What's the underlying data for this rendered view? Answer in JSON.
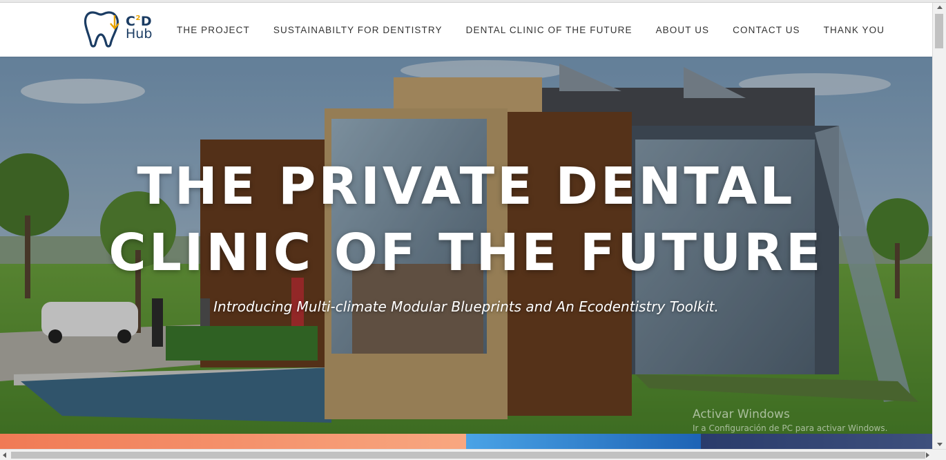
{
  "brand": {
    "logo_line1": "C",
    "logo_sup": "2",
    "logo_line1_end": "D",
    "logo_line2": "Hub",
    "colors": {
      "navy": "#1b3c63",
      "accent": "#e8a300"
    }
  },
  "nav": {
    "items": [
      {
        "label": "THE PROJECT"
      },
      {
        "label": "SUSTAINABILTY FOR DENTISTRY"
      },
      {
        "label": "DENTAL CLINIC OF THE FUTURE"
      },
      {
        "label": "ABOUT US"
      },
      {
        "label": "CONTACT US"
      },
      {
        "label": "THANK YOU"
      }
    ]
  },
  "hero": {
    "title_line1": "THE PRIVATE DENTAL",
    "title_line2": "CLINIC OF THE FUTURE",
    "subtitle": "Introducing Multi-climate Modular Blueprints and An Ecodentistry Toolkit."
  },
  "watermark": {
    "title": "Activar Windows",
    "subtitle": "Ir a Configuración de PC para activar Windows."
  }
}
